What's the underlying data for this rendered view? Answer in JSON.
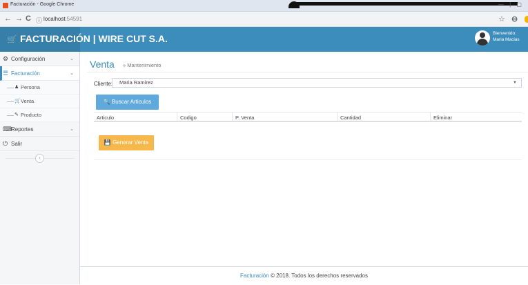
{
  "browser": {
    "window_title": "Facturación - Google Chrome",
    "window_controls": "— | ▢",
    "url_host": "localhost",
    "url_port": ":54591",
    "back_icon": "←",
    "forward_icon": "→",
    "reload_icon": "C",
    "info_icon": "ⓘ",
    "star_icon": "☆",
    "profile_icon": "⊖"
  },
  "header": {
    "brand": "FACTURACIÓN | WIRE CUT S.A.",
    "cart_icon": "🛒",
    "welcome_label": "Bienvenido:",
    "user_name": "Maria Macias"
  },
  "sidebar": {
    "items": [
      {
        "icon": "⚙",
        "label": "Configuración",
        "chevron": "⌄"
      },
      {
        "icon": "☰",
        "label": "Facturación",
        "chevron": "⌄"
      },
      {
        "icon": "⌨",
        "label": "Reportes",
        "chevron": "⌄"
      },
      {
        "icon": "⏻",
        "label": "Salir",
        "chevron": ""
      }
    ],
    "subitems": [
      {
        "icon": "♟",
        "label": "Persona"
      },
      {
        "icon": "🛒",
        "label": "Venta"
      },
      {
        "icon": "✎",
        "label": "Producto"
      }
    ],
    "collapse_icon": "‹"
  },
  "main": {
    "title": "Venta",
    "subtitle": "» Mantenimiento",
    "client_label": "Cliente:",
    "client_value": "Maria Ramirez",
    "select_arrow": "▼",
    "search_button": "Buscar Articulos",
    "search_icon": "🔍",
    "table_headers": [
      "Articulo",
      "Codigo",
      "P. Venta",
      "Cantidad",
      "Eliminar"
    ],
    "generate_button": "Generar Venta",
    "save_icon": "💾"
  },
  "footer": {
    "brand": "Facturación",
    "text": " © 2018. Todos los derechos reservados"
  }
}
